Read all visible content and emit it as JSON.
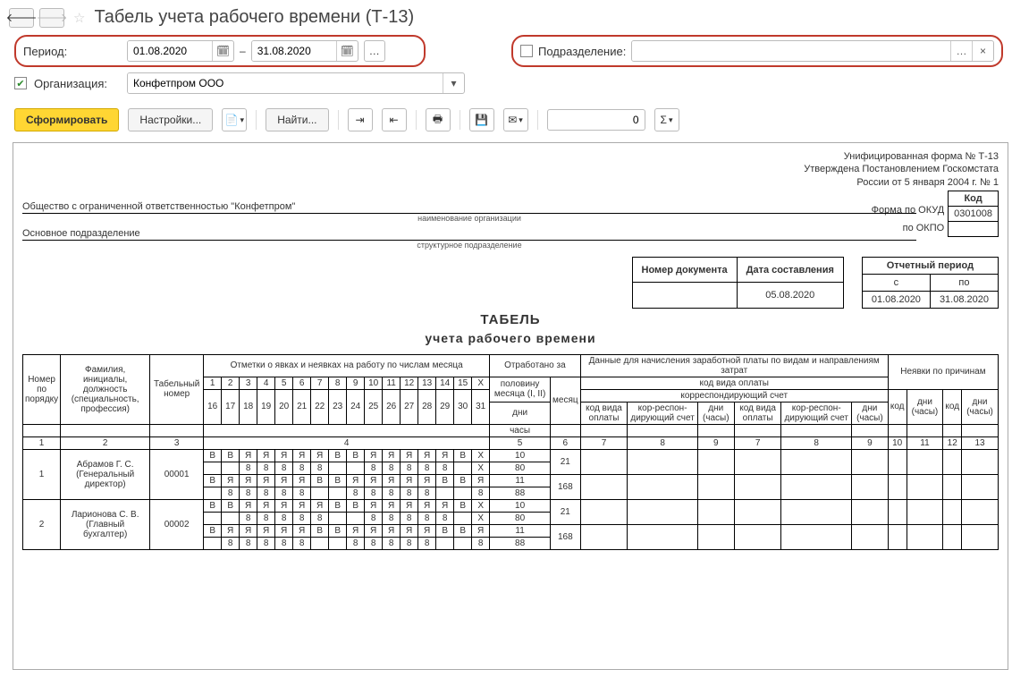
{
  "header": {
    "title": "Табель учета рабочего времени (Т-13)"
  },
  "filters": {
    "period_label": "Период:",
    "date_from": "01.08.2020",
    "dash": "–",
    "date_to": "31.08.2020",
    "subdivision_label": "Подразделение:",
    "subdivision_value": "",
    "organization_label": "Организация:",
    "organization_value": "Конфетпром ООО"
  },
  "toolbar": {
    "generate": "Сформировать",
    "settings": "Настройки...",
    "find": "Найти...",
    "number": "0"
  },
  "report": {
    "form_line1": "Унифицированная форма № Т-13",
    "form_line2": "Утверждена Постановлением Госкомстата",
    "form_line3": "России от 5 января 2004 г. № 1",
    "code_header": "Код",
    "okud_label": "Форма по ОКУД",
    "okud_value": "0301008",
    "okpo_label": "по ОКПО",
    "org_name": "Общество с ограниченной ответственностью \"Конфетпром\"",
    "org_sub": "наименование организации",
    "dept_name": "Основное подразделение",
    "dept_sub": "структурное подразделение",
    "doc_number_header": "Номер документа",
    "doc_date_header": "Дата составления",
    "doc_date_value": "05.08.2020",
    "rep_period_header": "Отчетный период",
    "rep_from_h": "с",
    "rep_to_h": "по",
    "rep_from": "01.08.2020",
    "rep_to": "31.08.2020",
    "title1": "ТАБЕЛЬ",
    "title2": "учета  рабочего времени",
    "cols": {
      "num": "Номер по порядку",
      "fio": "Фамилия, инициалы, должность (специальность, профессия)",
      "tab": "Табельный номер",
      "marks": "Отметки о явках и неявках на работу по числам месяца",
      "worked": "Отработано за",
      "half": "половину месяца (I, II)",
      "month": "месяц",
      "days": "дни",
      "hours": "часы",
      "wage": "Данные для начисления заработной платы по видам и направлениям затрат",
      "paycode": "код вида оплаты",
      "corr": "корреспондирующий счет",
      "paycode2": "код вида оплаты",
      "corr2": "кор-респон-дирующий счет",
      "dh": "дни (часы)",
      "absent": "Неявки по причинам",
      "code": "код",
      "x": "X"
    },
    "colnums": [
      "1",
      "2",
      "3",
      "4",
      "5",
      "6",
      "7",
      "8",
      "9",
      "7",
      "8",
      "9",
      "10",
      "11",
      "12",
      "13"
    ],
    "days1": [
      "1",
      "2",
      "3",
      "4",
      "5",
      "6",
      "7",
      "8",
      "9",
      "10",
      "11",
      "12",
      "13",
      "14",
      "15",
      "X"
    ],
    "days2": [
      "16",
      "17",
      "18",
      "19",
      "20",
      "21",
      "22",
      "23",
      "24",
      "25",
      "26",
      "27",
      "28",
      "29",
      "30",
      "31"
    ],
    "rows": [
      {
        "n": "1",
        "fio": "Абрамов Г. С. (Генеральный директор)",
        "tab": "00001",
        "line1": [
          "В",
          "В",
          "Я",
          "Я",
          "Я",
          "Я",
          "Я",
          "В",
          "В",
          "Я",
          "Я",
          "Я",
          "Я",
          "Я",
          "В",
          "X"
        ],
        "line2": [
          "",
          "",
          "8",
          "8",
          "8",
          "8",
          "8",
          "",
          "",
          "8",
          "8",
          "8",
          "8",
          "8",
          "",
          "X"
        ],
        "line3": [
          "В",
          "Я",
          "Я",
          "Я",
          "Я",
          "Я",
          "В",
          "В",
          "Я",
          "Я",
          "Я",
          "Я",
          "Я",
          "В",
          "В",
          "Я"
        ],
        "line4": [
          "",
          "8",
          "8",
          "8",
          "8",
          "8",
          "",
          "",
          "8",
          "8",
          "8",
          "8",
          "8",
          "",
          "",
          "8"
        ],
        "half1": "10",
        "half2": "80",
        "half3": "11",
        "half4": "88",
        "month_days": "21",
        "month_hours": "168"
      },
      {
        "n": "2",
        "fio": "Ларионова С. В. (Главный бухгалтер)",
        "tab": "00002",
        "line1": [
          "В",
          "В",
          "Я",
          "Я",
          "Я",
          "Я",
          "Я",
          "В",
          "В",
          "Я",
          "Я",
          "Я",
          "Я",
          "Я",
          "В",
          "X"
        ],
        "line2": [
          "",
          "",
          "8",
          "8",
          "8",
          "8",
          "8",
          "",
          "",
          "8",
          "8",
          "8",
          "8",
          "8",
          "",
          "X"
        ],
        "line3": [
          "В",
          "Я",
          "Я",
          "Я",
          "Я",
          "Я",
          "В",
          "В",
          "Я",
          "Я",
          "Я",
          "Я",
          "Я",
          "В",
          "В",
          "Я"
        ],
        "line4": [
          "",
          "8",
          "8",
          "8",
          "8",
          "8",
          "",
          "",
          "8",
          "8",
          "8",
          "8",
          "8",
          "",
          "",
          "8"
        ],
        "half1": "10",
        "half2": "80",
        "half3": "11",
        "half4": "88",
        "month_days": "21",
        "month_hours": "168"
      }
    ]
  }
}
